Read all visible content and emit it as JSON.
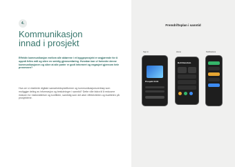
{
  "left": {
    "badge": "4.",
    "title_line1": "Kommunikasjon",
    "title_line2": "innad i prosjekt",
    "lead": "Effektiv kommunikasjon mellom alle aktørene i et byggeprosjekt er avgjørende for å oppnå felles mål og sikre en smidig gjennomføring. Hvordan kan vi forbedre denne kommunikasjonen og sikre at alle parter er godt informert og engasjert gjennom hele prosessen?",
    "body": "Hva om vi etablerte digitale samarbeidsplattformer og kommunikasjonsverktøy som muliggjør deling av informasjon og beslutninger i sanntid? Dette ville bidra til å redusere risikoen for misforståelser og konflikter, samtidig som det øker effektiviteten og kvaliteten på prosjektene."
  },
  "right": {
    "title": "Fremdriftsplan i sanntid",
    "phone1_label": "Sign in",
    "phone1_project": "Prosjekt 1144",
    "phone2_label": "Home",
    "phone2_heading": "Bolt Eiendom",
    "phone3_label": "Notifications"
  },
  "colors": {
    "accent": "#36756b",
    "panel_bg": "#f0f0ef",
    "phone_bg": "#1e1e1e"
  }
}
